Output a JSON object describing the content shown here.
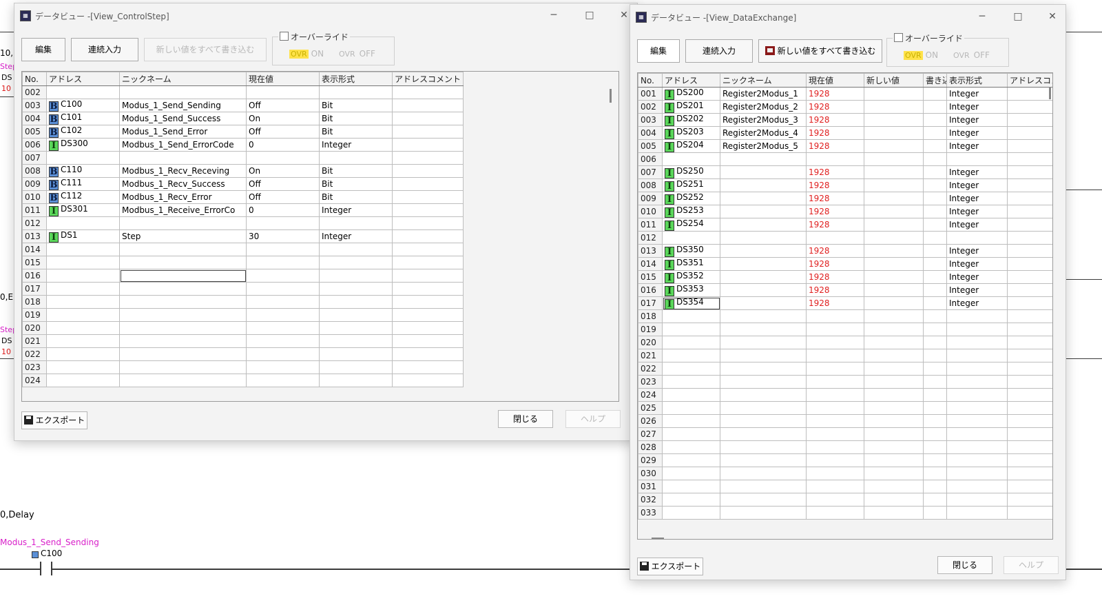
{
  "background": {
    "texts": [
      {
        "id": "bg-10",
        "text": "10,"
      },
      {
        "id": "bg-step1",
        "text": "Step",
        "cls": "pink"
      },
      {
        "id": "bg-ds1",
        "text": "DS"
      },
      {
        "id": "bg-ten1",
        "text": "10",
        "cls": "red"
      },
      {
        "id": "bg-0e",
        "text": "0,E"
      },
      {
        "id": "bg-step2",
        "text": "Step",
        "cls": "pink"
      },
      {
        "id": "bg-ds2",
        "text": "DS"
      },
      {
        "id": "bg-ten2",
        "text": "10",
        "cls": "red"
      },
      {
        "id": "bg-delay",
        "text": "0,Delay"
      },
      {
        "id": "bg-nick",
        "text": "Modus_1_Send_Sending",
        "cls": "pink"
      },
      {
        "id": "bg-c100",
        "text": "C100"
      }
    ]
  },
  "windows": {
    "control": {
      "title": "データビュー -[View_ControlStep]",
      "toolbar": {
        "edit": "編集",
        "continuous": "連続入力",
        "write_all": "新しい値をすべて書き込む",
        "override_label": "オーバーライド",
        "ovr": "OVR",
        "on": "ON",
        "ovr_off": "OVR",
        "off": "OFF"
      },
      "columns": [
        "No.",
        "アドレス",
        "ニックネーム",
        "現在値",
        "表示形式",
        "アドレスコメント"
      ],
      "rows": [
        {
          "no": "002",
          "type": "",
          "addr": "",
          "nick": "",
          "cur": "",
          "fmt": ""
        },
        {
          "no": "003",
          "type": "B",
          "addr": "C100",
          "nick": "Modus_1_Send_Sending",
          "cur": "Off",
          "fmt": "Bit"
        },
        {
          "no": "004",
          "type": "B",
          "addr": "C101",
          "nick": "Modus_1_Send_Success",
          "cur": "On",
          "fmt": "Bit"
        },
        {
          "no": "005",
          "type": "B",
          "addr": "C102",
          "nick": "Modus_1_Send_Error",
          "cur": "Off",
          "fmt": "Bit"
        },
        {
          "no": "006",
          "type": "I",
          "addr": "DS300",
          "nick": "Modbus_1_Send_ErrorCode",
          "cur": "0",
          "fmt": "Integer"
        },
        {
          "no": "007",
          "type": "",
          "addr": "",
          "nick": "",
          "cur": "",
          "fmt": ""
        },
        {
          "no": "008",
          "type": "B",
          "addr": "C110",
          "nick": "Modbus_1_Recv_Receving",
          "cur": "On",
          "fmt": "Bit"
        },
        {
          "no": "009",
          "type": "B",
          "addr": "C111",
          "nick": "Modbus_1_Recv_Success",
          "cur": "Off",
          "fmt": "Bit"
        },
        {
          "no": "010",
          "type": "B",
          "addr": "C112",
          "nick": "Modbus_1_Recv_Error",
          "cur": "Off",
          "fmt": "Bit"
        },
        {
          "no": "011",
          "type": "I",
          "addr": "DS301",
          "nick": "Modbus_1_Receive_ErrorCo",
          "cur": "0",
          "fmt": "Integer"
        },
        {
          "no": "012",
          "type": "",
          "addr": "",
          "nick": "",
          "cur": "",
          "fmt": ""
        },
        {
          "no": "013",
          "type": "I",
          "addr": "DS1",
          "nick": "Step",
          "cur": "30",
          "fmt": "Integer"
        },
        {
          "no": "014",
          "type": "",
          "addr": "",
          "nick": "",
          "cur": "",
          "fmt": ""
        },
        {
          "no": "015",
          "type": "",
          "addr": "",
          "nick": "",
          "cur": "",
          "fmt": ""
        },
        {
          "no": "016",
          "type": "",
          "addr": "",
          "nick": "",
          "cur": "",
          "fmt": "",
          "selected": true
        },
        {
          "no": "017",
          "type": "",
          "addr": "",
          "nick": "",
          "cur": "",
          "fmt": ""
        },
        {
          "no": "018",
          "type": "",
          "addr": "",
          "nick": "",
          "cur": "",
          "fmt": ""
        },
        {
          "no": "019",
          "type": "",
          "addr": "",
          "nick": "",
          "cur": "",
          "fmt": ""
        },
        {
          "no": "020",
          "type": "",
          "addr": "",
          "nick": "",
          "cur": "",
          "fmt": ""
        },
        {
          "no": "021",
          "type": "",
          "addr": "",
          "nick": "",
          "cur": "",
          "fmt": ""
        },
        {
          "no": "022",
          "type": "",
          "addr": "",
          "nick": "",
          "cur": "",
          "fmt": ""
        },
        {
          "no": "023",
          "type": "",
          "addr": "",
          "nick": "",
          "cur": "",
          "fmt": ""
        },
        {
          "no": "024",
          "type": "",
          "addr": "",
          "nick": "",
          "cur": "",
          "fmt": ""
        }
      ],
      "export": "エクスポート",
      "close": "閉じる",
      "help": "ヘルプ"
    },
    "exchange": {
      "title": "データビュー -[View_DataExchange]",
      "toolbar": {
        "edit": "編集",
        "continuous": "連続入力",
        "write_all": "新しい値をすべて書き込む",
        "override_label": "オーバーライド",
        "ovr": "OVR",
        "on": "ON",
        "ovr_off": "OVR",
        "off": "OFF"
      },
      "columns": [
        "No.",
        "アドレス",
        "ニックネーム",
        "現在値",
        "新しい値",
        "書き込",
        "表示形式",
        "アドレスコメ"
      ],
      "rows": [
        {
          "no": "001",
          "type": "I",
          "addr": "DS200",
          "nick": "Register2Modus_1",
          "cur": "1928",
          "fmt": "Integer"
        },
        {
          "no": "002",
          "type": "I",
          "addr": "DS201",
          "nick": "Register2Modus_2",
          "cur": "1928",
          "fmt": "Integer"
        },
        {
          "no": "003",
          "type": "I",
          "addr": "DS202",
          "nick": "Register2Modus_3",
          "cur": "1928",
          "fmt": "Integer"
        },
        {
          "no": "004",
          "type": "I",
          "addr": "DS203",
          "nick": "Register2Modus_4",
          "cur": "1928",
          "fmt": "Integer"
        },
        {
          "no": "005",
          "type": "I",
          "addr": "DS204",
          "nick": "Register2Modus_5",
          "cur": "1928",
          "fmt": "Integer"
        },
        {
          "no": "006",
          "type": "",
          "addr": "",
          "nick": "",
          "cur": "",
          "fmt": ""
        },
        {
          "no": "007",
          "type": "I",
          "addr": "DS250",
          "nick": "",
          "cur": "1928",
          "fmt": "Integer"
        },
        {
          "no": "008",
          "type": "I",
          "addr": "DS251",
          "nick": "",
          "cur": "1928",
          "fmt": "Integer"
        },
        {
          "no": "009",
          "type": "I",
          "addr": "DS252",
          "nick": "",
          "cur": "1928",
          "fmt": "Integer"
        },
        {
          "no": "010",
          "type": "I",
          "addr": "DS253",
          "nick": "",
          "cur": "1928",
          "fmt": "Integer"
        },
        {
          "no": "011",
          "type": "I",
          "addr": "DS254",
          "nick": "",
          "cur": "1928",
          "fmt": "Integer"
        },
        {
          "no": "012",
          "type": "",
          "addr": "",
          "nick": "",
          "cur": "",
          "fmt": ""
        },
        {
          "no": "013",
          "type": "I",
          "addr": "DS350",
          "nick": "",
          "cur": "1928",
          "fmt": "Integer"
        },
        {
          "no": "014",
          "type": "I",
          "addr": "DS351",
          "nick": "",
          "cur": "1928",
          "fmt": "Integer"
        },
        {
          "no": "015",
          "type": "I",
          "addr": "DS352",
          "nick": "",
          "cur": "1928",
          "fmt": "Integer"
        },
        {
          "no": "016",
          "type": "I",
          "addr": "DS353",
          "nick": "",
          "cur": "1928",
          "fmt": "Integer"
        },
        {
          "no": "017",
          "type": "I",
          "addr": "DS354",
          "nick": "",
          "cur": "1928",
          "fmt": "Integer",
          "selected": true
        },
        {
          "no": "018",
          "type": "",
          "addr": "",
          "nick": "",
          "cur": "",
          "fmt": ""
        },
        {
          "no": "019",
          "type": "",
          "addr": "",
          "nick": "",
          "cur": "",
          "fmt": ""
        },
        {
          "no": "020",
          "type": "",
          "addr": "",
          "nick": "",
          "cur": "",
          "fmt": ""
        },
        {
          "no": "021",
          "type": "",
          "addr": "",
          "nick": "",
          "cur": "",
          "fmt": ""
        },
        {
          "no": "022",
          "type": "",
          "addr": "",
          "nick": "",
          "cur": "",
          "fmt": ""
        },
        {
          "no": "023",
          "type": "",
          "addr": "",
          "nick": "",
          "cur": "",
          "fmt": ""
        },
        {
          "no": "024",
          "type": "",
          "addr": "",
          "nick": "",
          "cur": "",
          "fmt": ""
        },
        {
          "no": "025",
          "type": "",
          "addr": "",
          "nick": "",
          "cur": "",
          "fmt": ""
        },
        {
          "no": "026",
          "type": "",
          "addr": "",
          "nick": "",
          "cur": "",
          "fmt": ""
        },
        {
          "no": "027",
          "type": "",
          "addr": "",
          "nick": "",
          "cur": "",
          "fmt": ""
        },
        {
          "no": "028",
          "type": "",
          "addr": "",
          "nick": "",
          "cur": "",
          "fmt": ""
        },
        {
          "no": "029",
          "type": "",
          "addr": "",
          "nick": "",
          "cur": "",
          "fmt": ""
        },
        {
          "no": "030",
          "type": "",
          "addr": "",
          "nick": "",
          "cur": "",
          "fmt": ""
        },
        {
          "no": "031",
          "type": "",
          "addr": "",
          "nick": "",
          "cur": "",
          "fmt": ""
        },
        {
          "no": "032",
          "type": "",
          "addr": "",
          "nick": "",
          "cur": "",
          "fmt": ""
        },
        {
          "no": "033",
          "type": "",
          "addr": "",
          "nick": "",
          "cur": "",
          "fmt": ""
        }
      ],
      "export": "エクスポート",
      "close": "閉じる",
      "help": "ヘルプ"
    }
  },
  "colors": {
    "value_red": "#e02020",
    "bit_icon": "#5b8fd6",
    "int_icon": "#5ad65a",
    "override_yellow": "#ffe24a",
    "ladder_pink": "#d81ec9"
  },
  "icons": {
    "bit": "B",
    "int": "I",
    "minimize": "─",
    "maximize": "□",
    "close": "✕"
  }
}
